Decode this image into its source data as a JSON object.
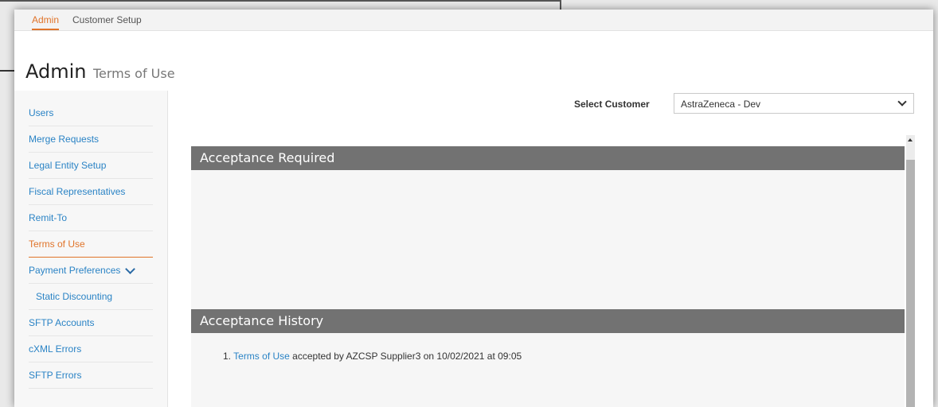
{
  "topnav": {
    "tabs": [
      {
        "label": "Admin"
      },
      {
        "label": "Customer Setup"
      }
    ]
  },
  "page": {
    "title": "Admin",
    "subtitle": "Terms of Use"
  },
  "sidebar": {
    "items": [
      {
        "label": "Users"
      },
      {
        "label": "Merge Requests"
      },
      {
        "label": "Legal Entity Setup"
      },
      {
        "label": "Fiscal Representatives"
      },
      {
        "label": "Remit-To"
      },
      {
        "label": "Terms of Use"
      },
      {
        "label": "Payment Preferences"
      },
      {
        "label": "Static Discounting"
      },
      {
        "label": "SFTP Accounts"
      },
      {
        "label": "cXML Errors"
      },
      {
        "label": "SFTP Errors"
      }
    ]
  },
  "customer_select": {
    "label": "Select Customer",
    "value": "AstraZeneca - Dev"
  },
  "sections": {
    "acceptance_required": {
      "title": "Acceptance Required"
    },
    "acceptance_history": {
      "title": "Acceptance History",
      "items": [
        {
          "number": "1.",
          "link": "Terms of Use",
          "text": "accepted by AZCSP Supplier3 on 10/02/2021 at 09:05"
        }
      ]
    }
  },
  "colors": {
    "accent": "#e0742a",
    "link": "#2a83c5",
    "header_bg": "#727272"
  },
  "icons": {
    "dropdown": "chevron-down-icon",
    "expand": "chevron-down-icon"
  }
}
